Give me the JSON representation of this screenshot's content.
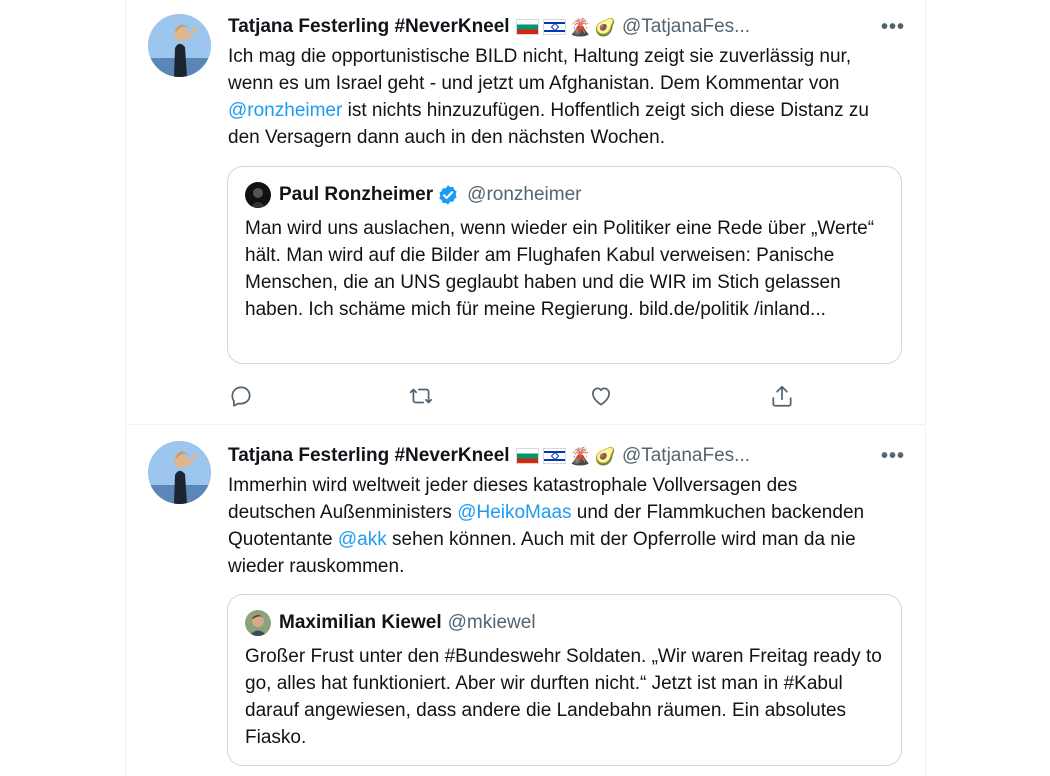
{
  "tweets": [
    {
      "author_name": "Tatjana Festerling #NeverKneel",
      "emoji": [
        "🇧🇬",
        "🇮🇱",
        "🌋",
        "🥑"
      ],
      "handle": "@TatjanaFes...",
      "more": "•••",
      "text_parts": [
        "Ich mag die opportunistische BILD nicht, Haltung zeigt sie zuverlässig nur, wenn es um Israel geht - und jetzt um Afghanistan. Dem Kommentar von ",
        "@ronzheimer",
        " ist nichts hinzuzufügen. Hoffentlich zeigt sich diese Distanz zu den Versagern dann auch in den nächsten Wochen."
      ],
      "quote": {
        "name": "Paul Ronzheimer",
        "verified": true,
        "handle": "@ronzheimer",
        "text": "Man wird uns auslachen, wenn wieder ein Politiker eine Rede über „Werte“ hält. Man wird auf die Bilder am Flughafen Kabul verweisen: Panische Menschen, die an UNS geglaubt haben und die WIR im Stich gelassen haben. Ich schäme mich für meine Regierung. bild.de/politik /inland..."
      },
      "actions": [
        "reply-icon",
        "retweet-icon",
        "like-icon",
        "share-icon"
      ]
    },
    {
      "author_name": "Tatjana Festerling #NeverKneel",
      "emoji": [
        "🇧🇬",
        "🇮🇱",
        "🌋",
        "🥑"
      ],
      "handle": "@TatjanaFes...",
      "more": "•••",
      "text_parts": [
        "Immerhin wird weltweit jeder dieses katastrophale Vollversagen des deutschen Außenministers ",
        "@HeikoMaas",
        " und der Flammkuchen backenden Quotentante ",
        "@akk",
        " sehen können. Auch mit der Opferrolle wird man da nie wieder rauskommen."
      ],
      "quote": {
        "name": "Maximilian Kiewel",
        "handle": "@mkiewel",
        "text": "Großer Frust unter den #Bundeswehr Soldaten. „Wir waren Freitag ready to go, alles hat funktioniert. Aber wir durften nicht.“ Jetzt ist man in #Kabul darauf angewiesen, dass andere die Landebahn räumen. Ein absolutes Fiasko."
      }
    }
  ]
}
